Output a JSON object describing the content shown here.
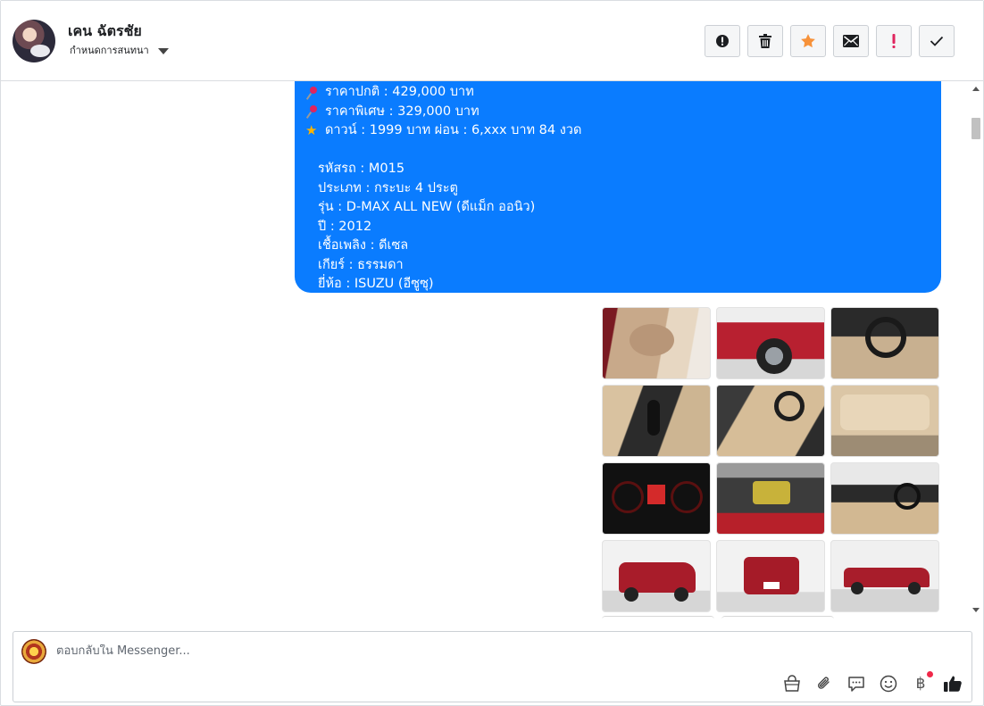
{
  "header": {
    "user_name": "เคน ฉัตรชัย",
    "conversation_setting": "กำหนดการสนทนา"
  },
  "toolbar": {
    "buttons": [
      "spam-icon",
      "trash-icon",
      "star-icon",
      "envelope-icon",
      "important-icon",
      "check-icon"
    ]
  },
  "message": {
    "lines": [
      {
        "icon": "pushpin",
        "text": "ราคาปกติ : 429,000 บาท"
      },
      {
        "icon": "pushpin",
        "text": "ราคาพิเศษ : 329,000 บาท"
      },
      {
        "icon": "star",
        "text": "ดาวน์ : 1999 บาท ผ่อน : 6,xxx บาท 84 งวด"
      }
    ],
    "details": [
      "รหัสรถ : M015",
      "ประเภท : กระบะ 4 ประตู",
      "รุ่น : D-MAX ALL NEW (ดีแม็ก ออนิว)",
      "ปี : 2012",
      "เชื้อเพลิง : ดีเซล",
      "เกียร์ : ธรรมดา",
      "ยี่ห้อ : ISUZU (อีซูซุ)"
    ]
  },
  "photos": [
    "door-interior",
    "red-pickup-side-wheel",
    "dashboard-steering",
    "gear-shift",
    "driver-seat",
    "rear-seats",
    "instrument-cluster",
    "engine-bay",
    "front-interior",
    "red-pickup-front-angle",
    "red-pickup-rear",
    "red-pickup-side"
  ],
  "composer": {
    "placeholder": "ตอบกลับใน Messenger...",
    "icons": [
      "shopping-bag-icon",
      "paperclip-icon",
      "saved-reply-icon",
      "emoji-icon",
      "baht-icon",
      "thumbs-up-icon"
    ],
    "baht_symbol": "฿"
  },
  "colors": {
    "bubble": "#0a7cff",
    "star": "#f7923a",
    "important": "#e0245e",
    "thumbs": "#1c1e21"
  }
}
